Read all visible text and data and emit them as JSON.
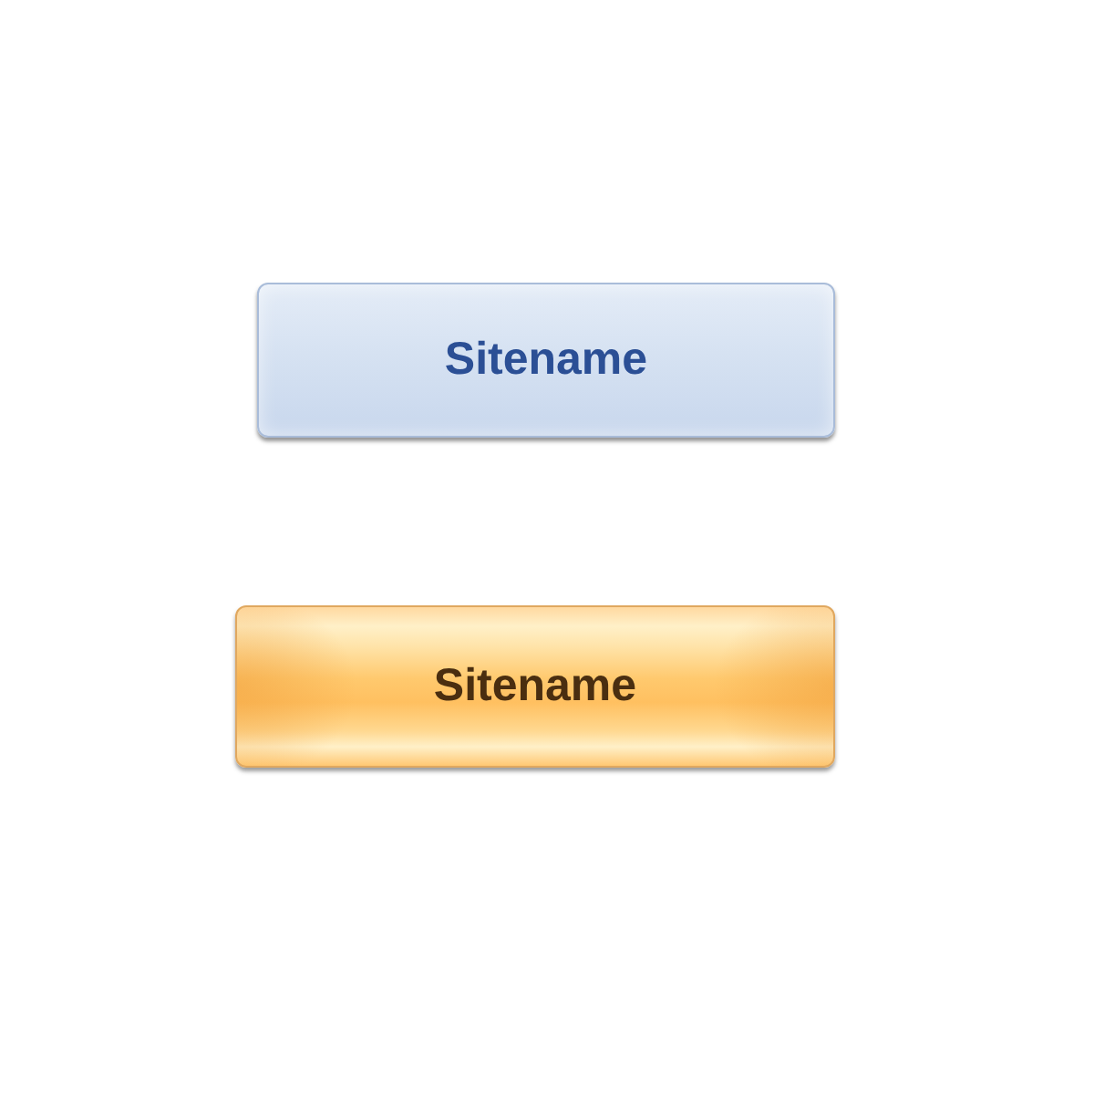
{
  "buttons": [
    {
      "label": "Sitename",
      "kind": "normal"
    },
    {
      "label": "Sitename",
      "kind": "highlighted"
    }
  ]
}
